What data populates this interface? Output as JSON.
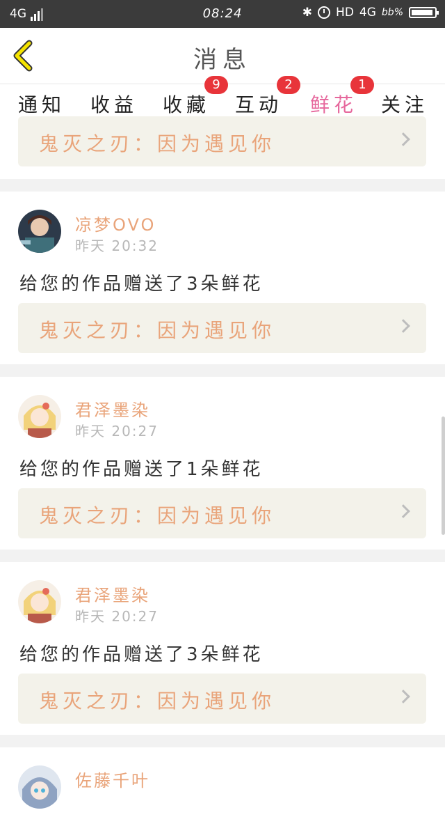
{
  "status_bar": {
    "network_left": "4G",
    "time": "08:24",
    "hd": "HD",
    "network_right": "4G",
    "speed": "bb%"
  },
  "header": {
    "title": "消息"
  },
  "tabs": [
    {
      "label": "通知",
      "badge": ""
    },
    {
      "label": "收益",
      "badge": ""
    },
    {
      "label": "收藏",
      "badge": "9"
    },
    {
      "label": "互动",
      "badge": "2"
    },
    {
      "label": "鲜花",
      "badge": "1",
      "active": true
    },
    {
      "label": "关注",
      "badge": ""
    }
  ],
  "feed": {
    "top_link": "鬼灭之刃：因为遇见你",
    "items": [
      {
        "username": "凉梦OVO",
        "time": "昨天  20:32",
        "message": "给您的作品赠送了3朵鲜花",
        "link": "鬼灭之刃：因为遇见你"
      },
      {
        "username": "君泽墨染",
        "time": "昨天  20:27",
        "message": "给您的作品赠送了1朵鲜花",
        "link": "鬼灭之刃：因为遇见你"
      },
      {
        "username": "君泽墨染",
        "time": "昨天  20:27",
        "message": "给您的作品赠送了3朵鲜花",
        "link": "鬼灭之刃：因为遇见你"
      },
      {
        "username": "佐藤千叶",
        "time": "",
        "message": "",
        "link": ""
      }
    ]
  },
  "colors": {
    "accent": "#e6679c",
    "link_text": "#e9a47a",
    "badge": "#e8343a",
    "back_arrow": "#f5e400"
  }
}
